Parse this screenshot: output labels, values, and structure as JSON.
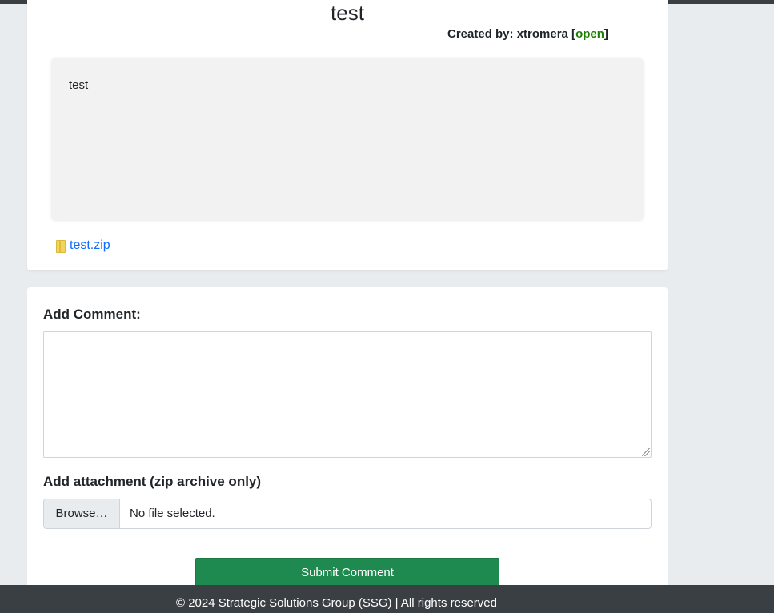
{
  "ticket": {
    "title": "test",
    "created_by_label": "Created by: xtromera [",
    "status": "open",
    "status_close": "]",
    "body": "test",
    "attachment_name": "test.zip"
  },
  "comment_form": {
    "comment_label": "Add Comment:",
    "comment_value": "",
    "attachment_label": "Add attachment (zip archive only)",
    "browse_label": "Browse…",
    "file_status": "No file selected.",
    "submit_label": "Submit Comment"
  },
  "footer": {
    "text": "© 2024 Strategic Solutions Group (SSG) | All rights reserved"
  },
  "colors": {
    "status_open": "#198000",
    "submit_button": "#1e8a4f",
    "link": "#0d6efd",
    "footer_bg": "#3a3f44"
  },
  "icons": {
    "attachment": "zip-file-icon"
  }
}
